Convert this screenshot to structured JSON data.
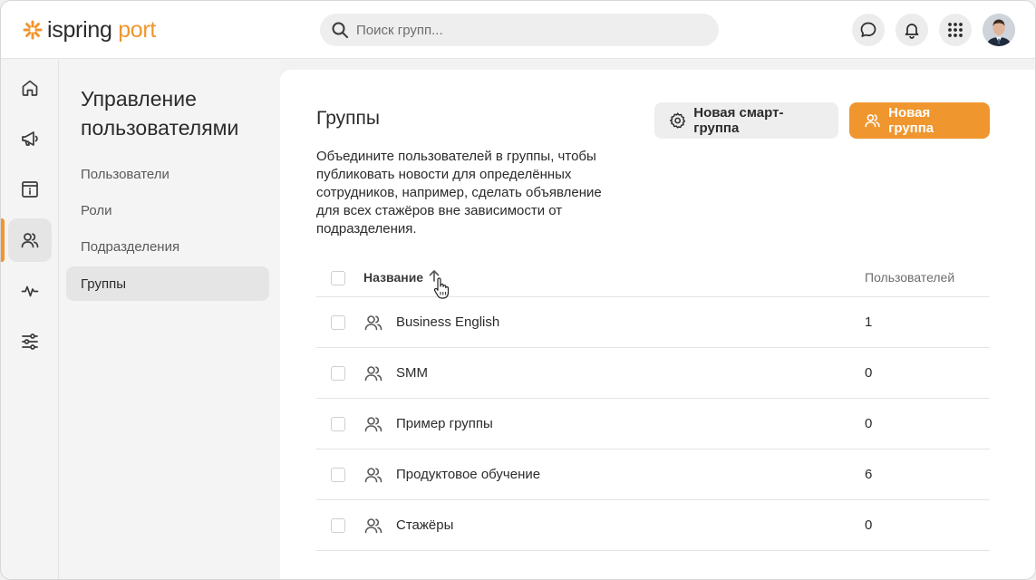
{
  "header": {
    "logo": {
      "part1": "ispring",
      "part2": "port"
    },
    "search": {
      "placeholder": "Поиск групп..."
    },
    "icons": [
      "search-icon",
      "chat-icon",
      "bell-icon",
      "apps-grid-icon"
    ]
  },
  "rail": {
    "items": [
      {
        "icon": "home-icon"
      },
      {
        "icon": "megaphone-icon"
      },
      {
        "icon": "info-icon"
      },
      {
        "icon": "users-icon",
        "active": true
      },
      {
        "icon": "activity-icon"
      },
      {
        "icon": "sliders-icon"
      }
    ]
  },
  "subnav": {
    "title": "Управление пользователями",
    "items": [
      {
        "label": "Пользователи"
      },
      {
        "label": "Роли"
      },
      {
        "label": "Подразделения"
      },
      {
        "label": "Группы",
        "active": true
      }
    ]
  },
  "main": {
    "title": "Группы",
    "description": "Объедините пользователей в группы, чтобы публиковать новости для определённых сотрудников, например, сделать объявление для всех стажёров вне зависимости от подразделения.",
    "buttons": {
      "smart_group": "Новая смарт-группа",
      "new_group": "Новая группа"
    },
    "table": {
      "columns": {
        "name": "Название",
        "users": "Пользователей"
      },
      "rows": [
        {
          "name": "Business English",
          "users": "1"
        },
        {
          "name": "SMM",
          "users": "0"
        },
        {
          "name": "Пример группы",
          "users": "0"
        },
        {
          "name": "Продуктовое обучение",
          "users": "6"
        },
        {
          "name": "Стажёры",
          "users": "0"
        }
      ]
    }
  },
  "colors": {
    "accent": "#f0962e",
    "text": "#2b2b2b",
    "muted": "#6d6d6d"
  }
}
